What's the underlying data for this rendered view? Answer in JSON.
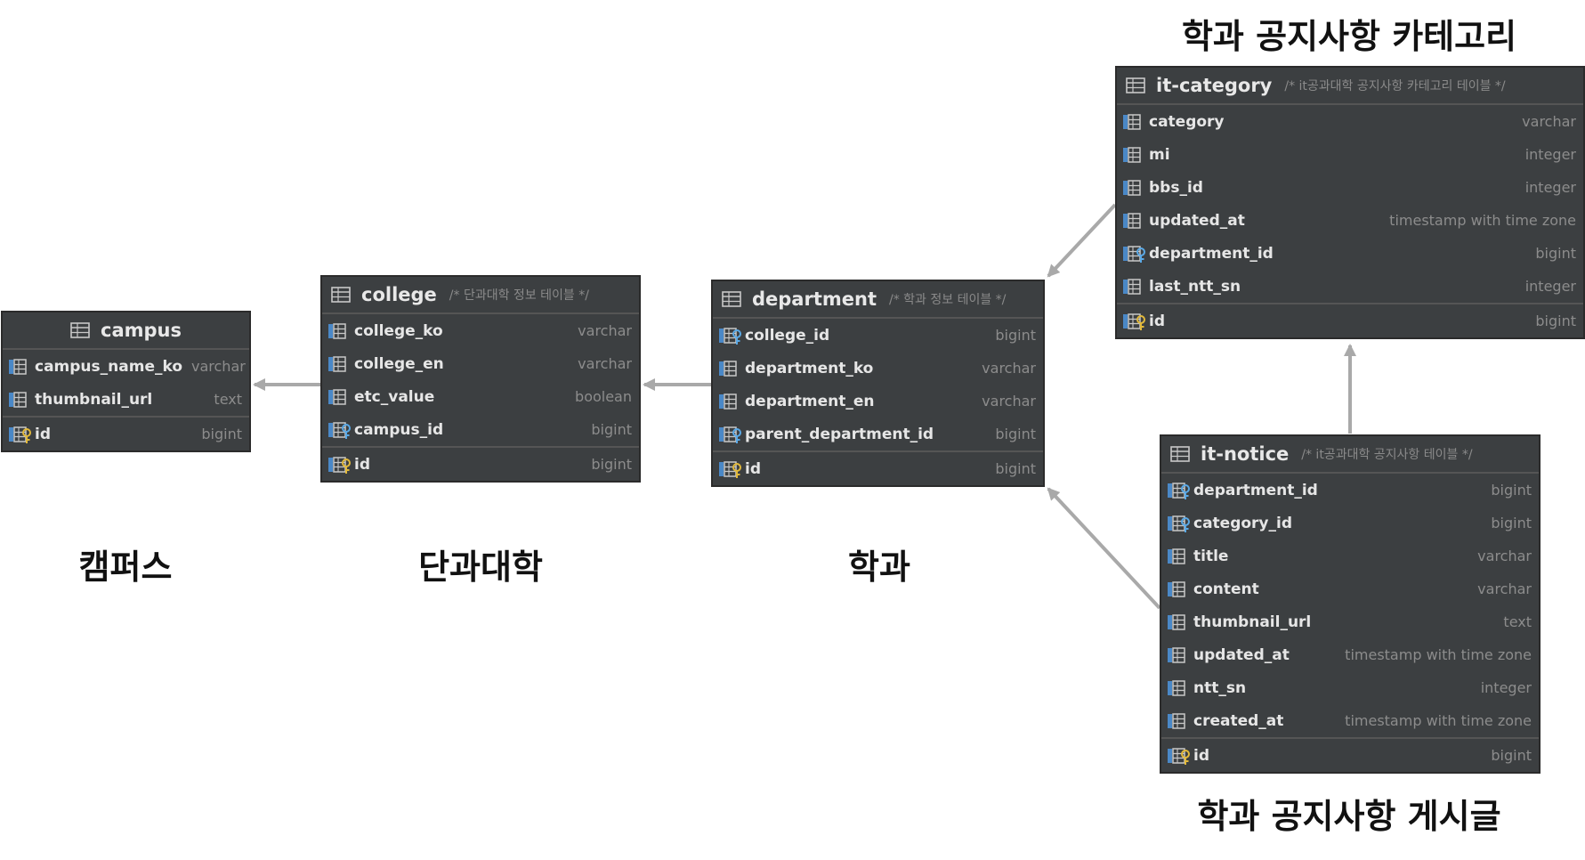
{
  "captions": {
    "campus": "캠퍼스",
    "college": "단과대학",
    "department": "학과",
    "category": "학과 공지사항 카테고리",
    "notice": "학과 공지사항 게시글"
  },
  "tables": {
    "campus": {
      "name": "campus",
      "comment": "",
      "columns": [
        {
          "name": "campus_name_ko",
          "type": "varchar",
          "kind": "column"
        },
        {
          "name": "thumbnail_url",
          "type": "text",
          "kind": "column"
        }
      ],
      "pk": {
        "name": "id",
        "type": "bigint",
        "kind": "pk"
      }
    },
    "college": {
      "name": "college",
      "comment": "/* 단과대학 정보 테이블 */",
      "columns": [
        {
          "name": "college_ko",
          "type": "varchar",
          "kind": "column"
        },
        {
          "name": "college_en",
          "type": "varchar",
          "kind": "column"
        },
        {
          "name": "etc_value",
          "type": "boolean",
          "kind": "column"
        },
        {
          "name": "campus_id",
          "type": "bigint",
          "kind": "fk"
        }
      ],
      "pk": {
        "name": "id",
        "type": "bigint",
        "kind": "pk"
      }
    },
    "department": {
      "name": "department",
      "comment": "/* 학과 정보 테이블 */",
      "columns": [
        {
          "name": "college_id",
          "type": "bigint",
          "kind": "fk"
        },
        {
          "name": "department_ko",
          "type": "varchar",
          "kind": "column"
        },
        {
          "name": "department_en",
          "type": "varchar",
          "kind": "column"
        },
        {
          "name": "parent_department_id",
          "type": "bigint",
          "kind": "fk"
        }
      ],
      "pk": {
        "name": "id",
        "type": "bigint",
        "kind": "pk"
      }
    },
    "category": {
      "name": "it-category",
      "comment": "/* it공과대학 공지사항 카테고리 테이블 */",
      "columns": [
        {
          "name": "category",
          "type": "varchar",
          "kind": "column"
        },
        {
          "name": "mi",
          "type": "integer",
          "kind": "column"
        },
        {
          "name": "bbs_id",
          "type": "integer",
          "kind": "column"
        },
        {
          "name": "updated_at",
          "type": "timestamp with time zone",
          "kind": "column"
        },
        {
          "name": "department_id",
          "type": "bigint",
          "kind": "fk"
        },
        {
          "name": "last_ntt_sn",
          "type": "integer",
          "kind": "column"
        }
      ],
      "pk": {
        "name": "id",
        "type": "bigint",
        "kind": "pk"
      }
    },
    "notice": {
      "name": "it-notice",
      "comment": "/* it공과대학 공지사항 테이블 */",
      "columns": [
        {
          "name": "department_id",
          "type": "bigint",
          "kind": "fk"
        },
        {
          "name": "category_id",
          "type": "bigint",
          "kind": "fk"
        },
        {
          "name": "title",
          "type": "varchar",
          "kind": "column"
        },
        {
          "name": "content",
          "type": "varchar",
          "kind": "column"
        },
        {
          "name": "thumbnail_url",
          "type": "text",
          "kind": "column"
        },
        {
          "name": "updated_at",
          "type": "timestamp with time zone",
          "kind": "column"
        },
        {
          "name": "ntt_sn",
          "type": "integer",
          "kind": "column"
        },
        {
          "name": "created_at",
          "type": "timestamp with time zone",
          "kind": "column"
        }
      ],
      "pk": {
        "name": "id",
        "type": "bigint",
        "kind": "pk"
      }
    }
  },
  "relations": [
    {
      "from": "college",
      "to": "campus"
    },
    {
      "from": "department",
      "to": "college"
    },
    {
      "from": "category",
      "to": "department"
    },
    {
      "from": "notice",
      "to": "department"
    },
    {
      "from": "notice",
      "to": "category"
    }
  ],
  "colors": {
    "table_bg": "#3c3f41",
    "table_border": "#2b2b2b",
    "divider": "#555555",
    "text": "#e6e6e6",
    "muted": "#8c8c8c",
    "connector": "#a9a9a9",
    "key_gold": "#e2b93b",
    "fk_blue": "#5aa9e6"
  }
}
